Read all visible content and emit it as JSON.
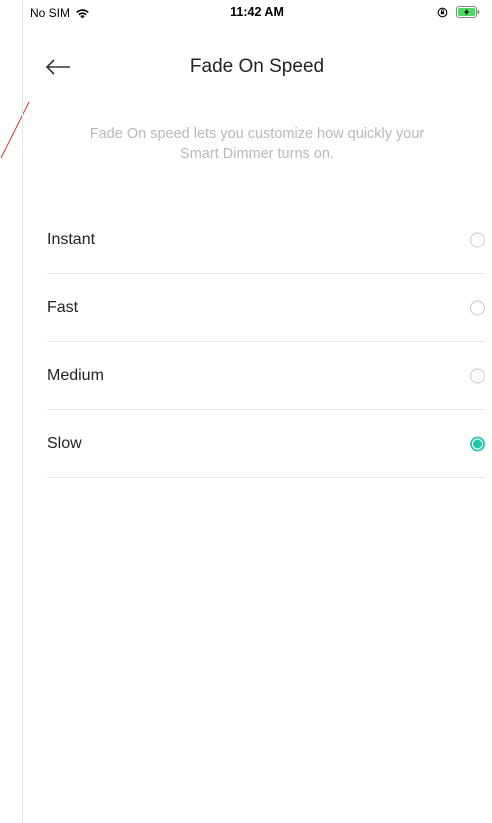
{
  "status_bar": {
    "carrier": "No SIM",
    "time": "11:42 AM",
    "icons": [
      "wifi-icon",
      "orientation-lock-icon",
      "battery-charging-icon"
    ]
  },
  "header": {
    "title": "Fade On Speed",
    "back_icon": "arrow-left-icon"
  },
  "description": {
    "line1": "Fade On speed lets you customize how quickly your",
    "line2": "Smart Dimmer turns on."
  },
  "options": [
    {
      "label": "Instant",
      "selected": false
    },
    {
      "label": "Fast",
      "selected": false
    },
    {
      "label": "Medium",
      "selected": false
    },
    {
      "label": "Slow",
      "selected": true
    }
  ],
  "colors": {
    "accent": "#20c9ad",
    "battery_fill": "#4cd964",
    "text_primary": "#222222",
    "text_secondary": "#b8b8b8",
    "divider": "#e7e7e7"
  }
}
